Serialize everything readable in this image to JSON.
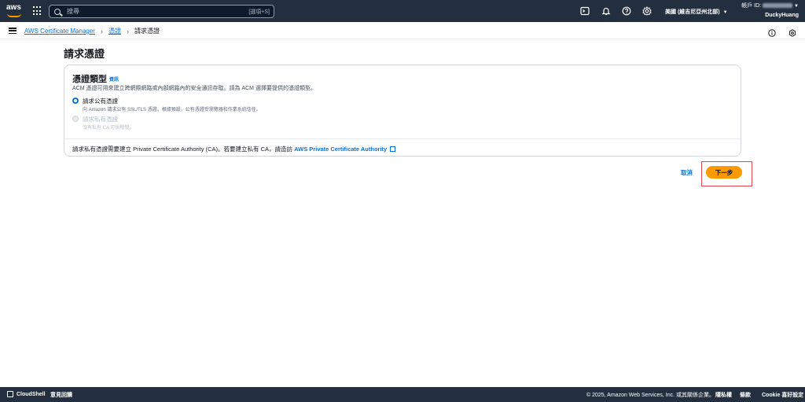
{
  "topbar": {
    "logo_text": "aws",
    "search_placeholder": "搜尋",
    "search_shortcut": "[選項+S]",
    "region": "美國 (維吉尼亞州北部)",
    "account_label": "帳戶 ID:",
    "username": "DuckyHuang",
    "icons": [
      "cloudshell-icon",
      "bell-icon",
      "help-icon",
      "gear-icon"
    ]
  },
  "breadcrumb": {
    "items": [
      "AWS Certificate Manager",
      "憑證",
      "請求憑證"
    ]
  },
  "page": {
    "title": "請求憑證"
  },
  "card": {
    "title": "憑證類型",
    "info_link": "資訊",
    "description": "ACM 憑證可用來建立跨網際網路或內部網路內的安全通訊存取。請為 ACM 選擇要提供的憑證類型。",
    "options": [
      {
        "label": "請求公有憑證",
        "description": "向 Amazon 請求公有 SSL/TLS 憑證。根據預設，公有憑證受瀏覽器和作業系統信任。",
        "selected": true,
        "disabled": false
      },
      {
        "label": "請求私有憑證",
        "description": "沒有私有 CA 可供撥發。",
        "selected": false,
        "disabled": true
      }
    ],
    "footer_text": "請求私有憑證需要建立 Private Certificate Authority (CA)。若要建立私有 CA，請造訪",
    "footer_link": "AWS Private Certificate Authority"
  },
  "actions": {
    "cancel": "取消",
    "next": "下一步"
  },
  "footer": {
    "cloudshell": "CloudShell",
    "feedback": "意見回饋",
    "copyright": "© 2025, Amazon Web Services, Inc. 或其關係企業。",
    "privacy": "隱私權",
    "terms": "條款",
    "cookie": "Cookie 喜好設定"
  },
  "colors": {
    "nav_bg": "#232f3e",
    "accent": "#0972d3",
    "primary_button": "#ff9900",
    "highlight_box": "#e0454f"
  }
}
